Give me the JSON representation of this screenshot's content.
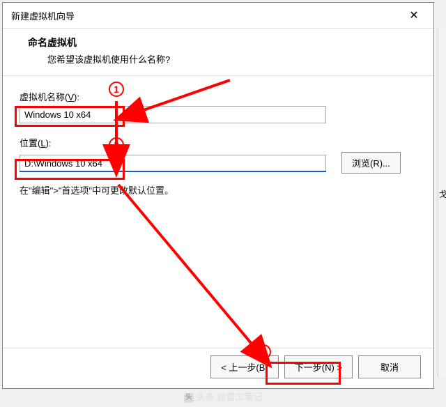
{
  "window": {
    "title": "新建虚拟机向导",
    "close_glyph": "✕"
  },
  "header": {
    "title": "命名虚拟机",
    "subtitle": "您希望该虚拟机使用什么名称?"
  },
  "fields": {
    "name_label_pre": "虚拟机名称(",
    "name_label_u": "V",
    "name_label_post": "):",
    "name_value": "Windows 10 x64",
    "location_label_pre": "位置(",
    "location_label_u": "L",
    "location_label_post": "):",
    "location_value": "D:\\Windows 10 x64",
    "browse_label": "浏览(R)...",
    "hint": "在\"编辑\">\"首选项\"中可更改默认位置。"
  },
  "buttons": {
    "back": "< 上一步(B)",
    "next": "下一步(N) >",
    "cancel": "取消"
  },
  "annotations": {
    "n1": "1",
    "n2": "2",
    "n3": "3"
  },
  "watermark": {
    "text": "头条 @雷工笔记"
  },
  "edge": {
    "char": "戈"
  }
}
